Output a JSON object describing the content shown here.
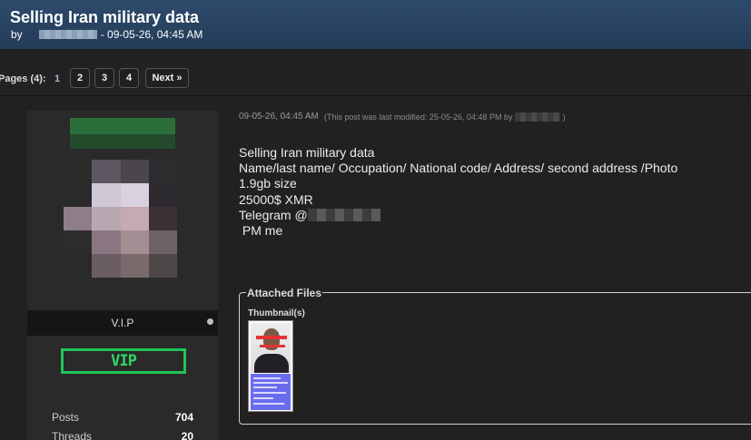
{
  "thread": {
    "title": "Selling Iran military data",
    "by_prefix": "by",
    "date_suffix": "- 09-05-26, 04:45 AM"
  },
  "pagination": {
    "label": "Pages (4):",
    "current": "1",
    "pages": [
      "2",
      "3",
      "4"
    ],
    "next": "Next »"
  },
  "user": {
    "rank": "V.I.P",
    "badge": "VIP",
    "stats": [
      {
        "label": "Posts",
        "value": "704"
      },
      {
        "label": "Threads",
        "value": "20"
      }
    ]
  },
  "post": {
    "date": "09-05-26, 04:45 AM",
    "edited_prefix": "(This post was last modified: 25-05-26, 04:48 PM by",
    "edited_suffix": ")",
    "lines": [
      "Selling Iran military data",
      "Name/last name/ Occupation/ National code/ Address/ second address /Photo",
      "1.9gb size",
      "25000$ XMR",
      "Telegram @",
      " PM me"
    ]
  },
  "attachments": {
    "legend": "Attached Files",
    "thumbnail_label": "Thumbnail(s)"
  },
  "colors": {
    "header": "#2a4565",
    "badge_green": "#22c35a",
    "censor_red": "#e23434"
  }
}
